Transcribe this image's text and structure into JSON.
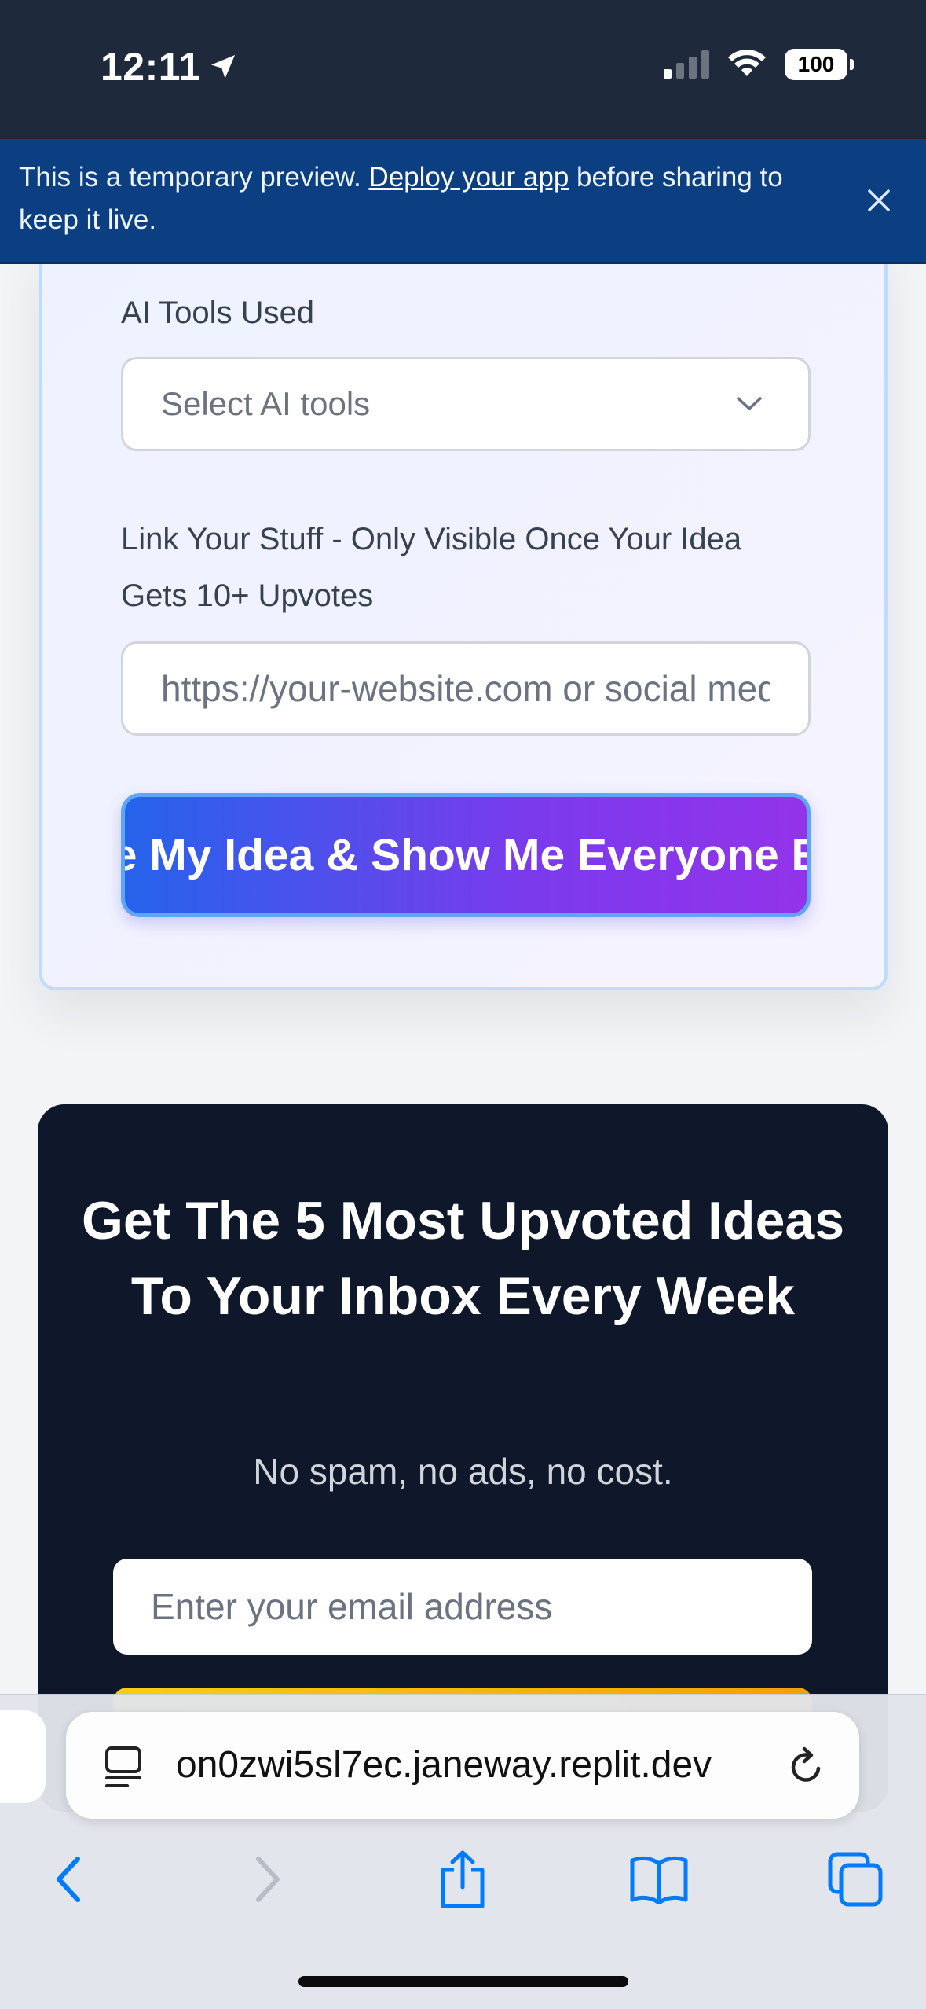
{
  "status_bar": {
    "time": "12:11",
    "battery": "100"
  },
  "banner": {
    "text_before": "This is a temporary preview. ",
    "link": "Deploy your app",
    "text_after": " before sharing to keep it live."
  },
  "form": {
    "ai_tools_label": "AI Tools Used",
    "ai_tools_placeholder": "Select AI tools",
    "link_label": "Link Your Stuff - Only Visible Once Your Idea Gets 10+ Upvotes",
    "link_placeholder": "https://your-website.com or social media",
    "share_button": "Share My Idea & Show Me Everyone Else's"
  },
  "newsletter": {
    "title": "Get The 5 Most Upvoted Ideas To Your Inbox Every Week",
    "subtitle": "No spam, no ads, no cost.",
    "email_placeholder": "Enter your email address"
  },
  "browser": {
    "url": "on0zwi5sl7ec.janeway.replit.dev"
  },
  "colors": {
    "banner": "#0b3f82",
    "status_bar": "#1e293b",
    "news_card": "#0f172a",
    "button_gradient_start": "#2563eb",
    "button_gradient_end": "#9333ea",
    "safari_blue": "#007aff"
  }
}
